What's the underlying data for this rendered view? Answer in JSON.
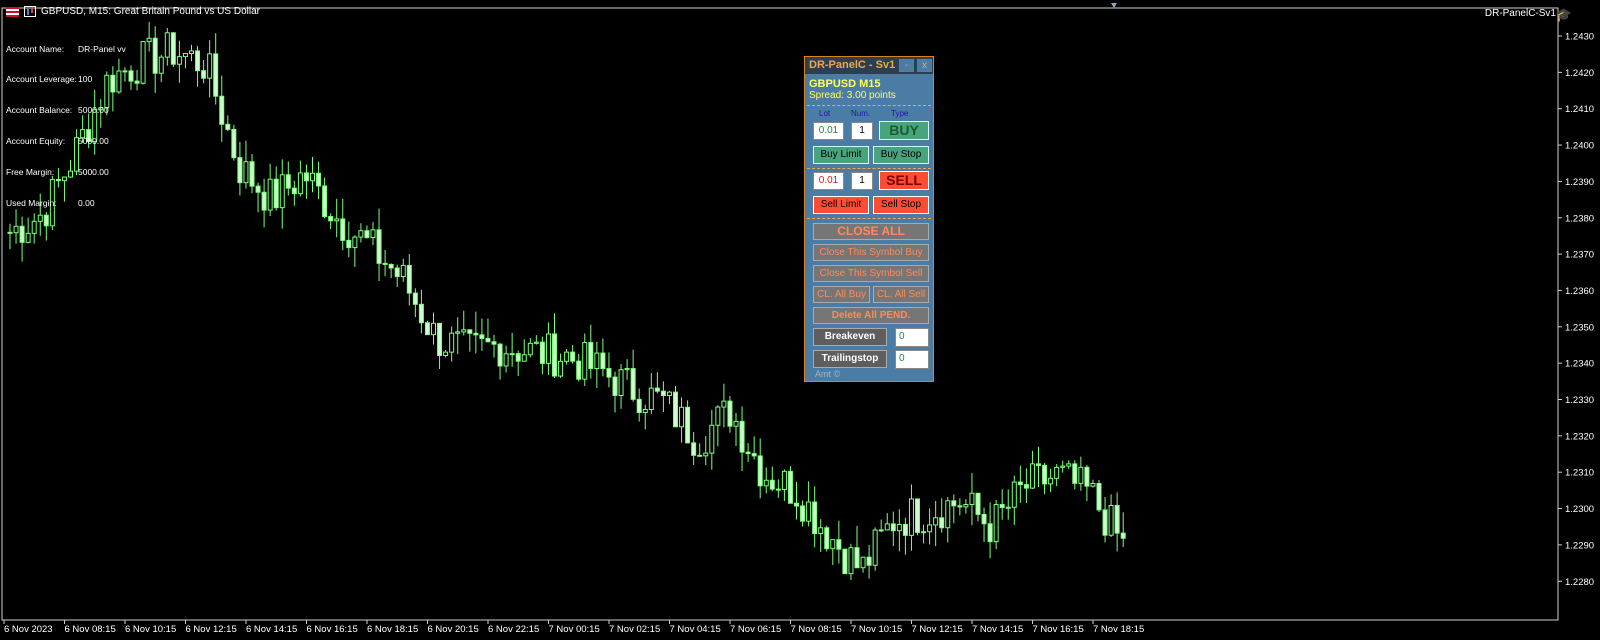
{
  "window": {
    "title": "GBPUSD, M15:  Great Britain Pound vs US Dollar",
    "expert_label": "DR-PanelC-Sv1",
    "icons": [
      "gb-flag-icon",
      "chart-icon",
      "graduation-cap-icon"
    ]
  },
  "account": [
    {
      "label": "Account Name:",
      "value": "DR-Panel vv"
    },
    {
      "label": "Account Leverage:",
      "value": "100"
    },
    {
      "label": "Account Balance:",
      "value": "5000.00"
    },
    {
      "label": "Account Equity:",
      "value": "5000.00"
    },
    {
      "label": "Free Margin:",
      "value": "5000.00"
    },
    {
      "label": "Used Margin:",
      "value": "0.00"
    }
  ],
  "panel": {
    "title": "DR-PanelC - Sv1",
    "minimize": "-",
    "close": "x",
    "symbol": "GBPUSD  M15",
    "spread": "Spread: 3.00 points",
    "labels": {
      "lot": "Lot",
      "num": "Num.",
      "type": "Type"
    },
    "buy": {
      "lot": "0.01",
      "num": "1",
      "button": "BUY",
      "limit": "Buy  Limit",
      "stop": "Buy  Stop"
    },
    "sell": {
      "lot": "0.01",
      "num": "1",
      "button": "SELL",
      "limit": "Sell  Limit",
      "stop": "Sell  Stop"
    },
    "close_all": "CLOSE  ALL",
    "close_symbol_buy": "Close This Symbol Buy",
    "close_symbol_sell": "Close This Symbol Sell",
    "cl_all_buy": "CL. All Buy",
    "cl_all_sell": "CL. All Sell",
    "delete_pending": "Delete All PEND.",
    "breakeven": {
      "label": "Breakeven",
      "value": "0"
    },
    "trailingstop": {
      "label": "Trailingstop",
      "value": "0"
    },
    "footer": "Amt ©"
  },
  "chart_data": {
    "type": "candlestick",
    "symbol": "GBPUSD",
    "timeframe": "M15",
    "ylim": [
      1.227,
      1.2435
    ],
    "y_ticks": [
      "1.2430",
      "1.2420",
      "1.2410",
      "1.2400",
      "1.2390",
      "1.2380",
      "1.2370",
      "1.2360",
      "1.2350",
      "1.2340",
      "1.2330",
      "1.2320",
      "1.2310",
      "1.2300",
      "1.2290",
      "1.2280"
    ],
    "x_ticks": [
      "6 Nov 2023",
      "6 Nov 08:15",
      "6 Nov 10:15",
      "6 Nov 12:15",
      "6 Nov 14:15",
      "6 Nov 16:15",
      "6 Nov 18:15",
      "6 Nov 20:15",
      "6 Nov 22:15",
      "7 Nov 00:15",
      "7 Nov 02:15",
      "7 Nov 04:15",
      "7 Nov 06:15",
      "7 Nov 08:15",
      "7 Nov 10:15",
      "7 Nov 12:15",
      "7 Nov 14:15",
      "7 Nov 16:15",
      "7 Nov 18:15"
    ],
    "bull_color": "#7cff7c",
    "bear_color": "#ccffcc",
    "key_closes": [
      1.2376,
      1.2381,
      1.2398,
      1.2418,
      1.2423,
      1.2426,
      1.2422,
      1.2394,
      1.2385,
      1.2392,
      1.238,
      1.2372,
      1.2363,
      1.2347,
      1.2343,
      1.2345,
      1.2343,
      1.2342,
      1.2338,
      1.2333,
      1.2329,
      1.2319,
      1.2327,
      1.231,
      1.2305,
      1.2293,
      1.2283,
      1.2297,
      1.2299,
      1.2302,
      1.2295,
      1.2306,
      1.2309,
      1.2304,
      1.229
    ]
  }
}
